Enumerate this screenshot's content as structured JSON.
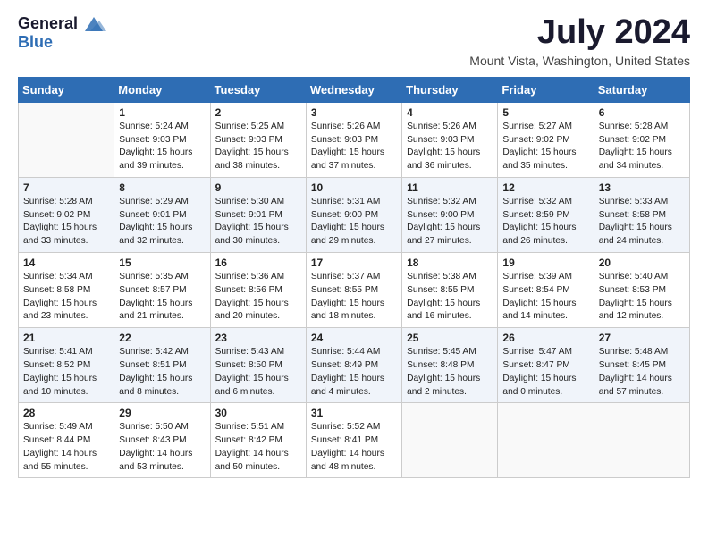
{
  "header": {
    "logo_general": "General",
    "logo_blue": "Blue",
    "month_title": "July 2024",
    "location": "Mount Vista, Washington, United States"
  },
  "calendar": {
    "headers": [
      "Sunday",
      "Monday",
      "Tuesday",
      "Wednesday",
      "Thursday",
      "Friday",
      "Saturday"
    ],
    "weeks": [
      [
        {
          "day": "",
          "info": ""
        },
        {
          "day": "1",
          "info": "Sunrise: 5:24 AM\nSunset: 9:03 PM\nDaylight: 15 hours\nand 39 minutes."
        },
        {
          "day": "2",
          "info": "Sunrise: 5:25 AM\nSunset: 9:03 PM\nDaylight: 15 hours\nand 38 minutes."
        },
        {
          "day": "3",
          "info": "Sunrise: 5:26 AM\nSunset: 9:03 PM\nDaylight: 15 hours\nand 37 minutes."
        },
        {
          "day": "4",
          "info": "Sunrise: 5:26 AM\nSunset: 9:03 PM\nDaylight: 15 hours\nand 36 minutes."
        },
        {
          "day": "5",
          "info": "Sunrise: 5:27 AM\nSunset: 9:02 PM\nDaylight: 15 hours\nand 35 minutes."
        },
        {
          "day": "6",
          "info": "Sunrise: 5:28 AM\nSunset: 9:02 PM\nDaylight: 15 hours\nand 34 minutes."
        }
      ],
      [
        {
          "day": "7",
          "info": "Sunrise: 5:28 AM\nSunset: 9:02 PM\nDaylight: 15 hours\nand 33 minutes."
        },
        {
          "day": "8",
          "info": "Sunrise: 5:29 AM\nSunset: 9:01 PM\nDaylight: 15 hours\nand 32 minutes."
        },
        {
          "day": "9",
          "info": "Sunrise: 5:30 AM\nSunset: 9:01 PM\nDaylight: 15 hours\nand 30 minutes."
        },
        {
          "day": "10",
          "info": "Sunrise: 5:31 AM\nSunset: 9:00 PM\nDaylight: 15 hours\nand 29 minutes."
        },
        {
          "day": "11",
          "info": "Sunrise: 5:32 AM\nSunset: 9:00 PM\nDaylight: 15 hours\nand 27 minutes."
        },
        {
          "day": "12",
          "info": "Sunrise: 5:32 AM\nSunset: 8:59 PM\nDaylight: 15 hours\nand 26 minutes."
        },
        {
          "day": "13",
          "info": "Sunrise: 5:33 AM\nSunset: 8:58 PM\nDaylight: 15 hours\nand 24 minutes."
        }
      ],
      [
        {
          "day": "14",
          "info": "Sunrise: 5:34 AM\nSunset: 8:58 PM\nDaylight: 15 hours\nand 23 minutes."
        },
        {
          "day": "15",
          "info": "Sunrise: 5:35 AM\nSunset: 8:57 PM\nDaylight: 15 hours\nand 21 minutes."
        },
        {
          "day": "16",
          "info": "Sunrise: 5:36 AM\nSunset: 8:56 PM\nDaylight: 15 hours\nand 20 minutes."
        },
        {
          "day": "17",
          "info": "Sunrise: 5:37 AM\nSunset: 8:55 PM\nDaylight: 15 hours\nand 18 minutes."
        },
        {
          "day": "18",
          "info": "Sunrise: 5:38 AM\nSunset: 8:55 PM\nDaylight: 15 hours\nand 16 minutes."
        },
        {
          "day": "19",
          "info": "Sunrise: 5:39 AM\nSunset: 8:54 PM\nDaylight: 15 hours\nand 14 minutes."
        },
        {
          "day": "20",
          "info": "Sunrise: 5:40 AM\nSunset: 8:53 PM\nDaylight: 15 hours\nand 12 minutes."
        }
      ],
      [
        {
          "day": "21",
          "info": "Sunrise: 5:41 AM\nSunset: 8:52 PM\nDaylight: 15 hours\nand 10 minutes."
        },
        {
          "day": "22",
          "info": "Sunrise: 5:42 AM\nSunset: 8:51 PM\nDaylight: 15 hours\nand 8 minutes."
        },
        {
          "day": "23",
          "info": "Sunrise: 5:43 AM\nSunset: 8:50 PM\nDaylight: 15 hours\nand 6 minutes."
        },
        {
          "day": "24",
          "info": "Sunrise: 5:44 AM\nSunset: 8:49 PM\nDaylight: 15 hours\nand 4 minutes."
        },
        {
          "day": "25",
          "info": "Sunrise: 5:45 AM\nSunset: 8:48 PM\nDaylight: 15 hours\nand 2 minutes."
        },
        {
          "day": "26",
          "info": "Sunrise: 5:47 AM\nSunset: 8:47 PM\nDaylight: 15 hours\nand 0 minutes."
        },
        {
          "day": "27",
          "info": "Sunrise: 5:48 AM\nSunset: 8:45 PM\nDaylight: 14 hours\nand 57 minutes."
        }
      ],
      [
        {
          "day": "28",
          "info": "Sunrise: 5:49 AM\nSunset: 8:44 PM\nDaylight: 14 hours\nand 55 minutes."
        },
        {
          "day": "29",
          "info": "Sunrise: 5:50 AM\nSunset: 8:43 PM\nDaylight: 14 hours\nand 53 minutes."
        },
        {
          "day": "30",
          "info": "Sunrise: 5:51 AM\nSunset: 8:42 PM\nDaylight: 14 hours\nand 50 minutes."
        },
        {
          "day": "31",
          "info": "Sunrise: 5:52 AM\nSunset: 8:41 PM\nDaylight: 14 hours\nand 48 minutes."
        },
        {
          "day": "",
          "info": ""
        },
        {
          "day": "",
          "info": ""
        },
        {
          "day": "",
          "info": ""
        }
      ]
    ]
  }
}
